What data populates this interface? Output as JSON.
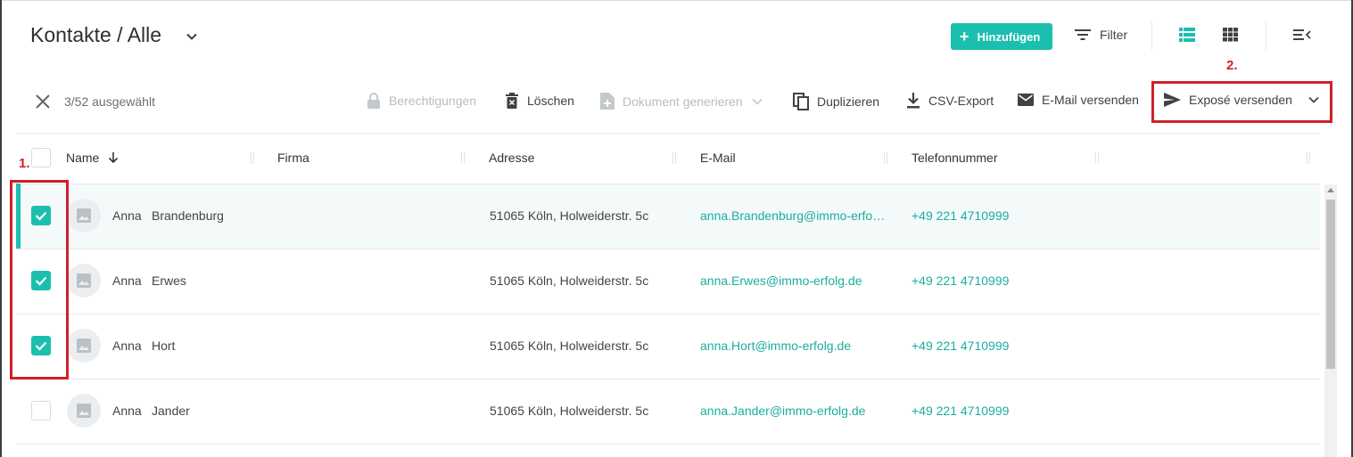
{
  "header": {
    "title": "Kontakte / Alle",
    "add_label": "Hinzufügen",
    "filter_label": "Filter"
  },
  "annotations": {
    "step1": "1.",
    "step2": "2."
  },
  "selection": {
    "count_text": "3/52 ausgewählt"
  },
  "actions": {
    "permissions": "Berechtigungen",
    "delete": "Löschen",
    "generate_doc": "Dokument generieren",
    "duplicate": "Duplizieren",
    "csv_export": "CSV-Export",
    "send_email": "E-Mail versenden",
    "send_expose": "Exposé versenden"
  },
  "table": {
    "columns": [
      "Name",
      "Firma",
      "Adresse",
      "E-Mail",
      "Telefonnummer"
    ],
    "rows": [
      {
        "first": "Anna",
        "last": "Brandenburg",
        "company": "",
        "address": "51065 Köln, Holweiderstr. 5c",
        "email": "anna.Brandenburg@immo-erfo…",
        "phone": "+49 221 4710999",
        "checked": true
      },
      {
        "first": "Anna",
        "last": "Erwes",
        "company": "",
        "address": "51065 Köln, Holweiderstr. 5c",
        "email": "anna.Erwes@immo-erfolg.de",
        "phone": "+49 221 4710999",
        "checked": true
      },
      {
        "first": "Anna",
        "last": "Hort",
        "company": "",
        "address": "51065 Köln, Holweiderstr. 5c",
        "email": "anna.Hort@immo-erfolg.de",
        "phone": "+49 221 4710999",
        "checked": true
      },
      {
        "first": "Anna",
        "last": "Jander",
        "company": "",
        "address": "51065 Köln, Holweiderstr. 5c",
        "email": "anna.Jander@immo-erfolg.de",
        "phone": "+49 221 4710999",
        "checked": false
      }
    ]
  },
  "colors": {
    "accent": "#1bbfb0",
    "annotation": "#d0202a",
    "link": "#1aae9f"
  },
  "icons": {
    "title_dropdown": "chevron-down-icon",
    "add": "plus-icon",
    "filter": "filter-icon",
    "list_view": "list-view-icon",
    "grid_view": "grid-view-icon",
    "collapse": "collapse-menu-icon",
    "close": "close-icon",
    "sort": "arrow-down-icon",
    "avatar": "image-placeholder-icon"
  }
}
